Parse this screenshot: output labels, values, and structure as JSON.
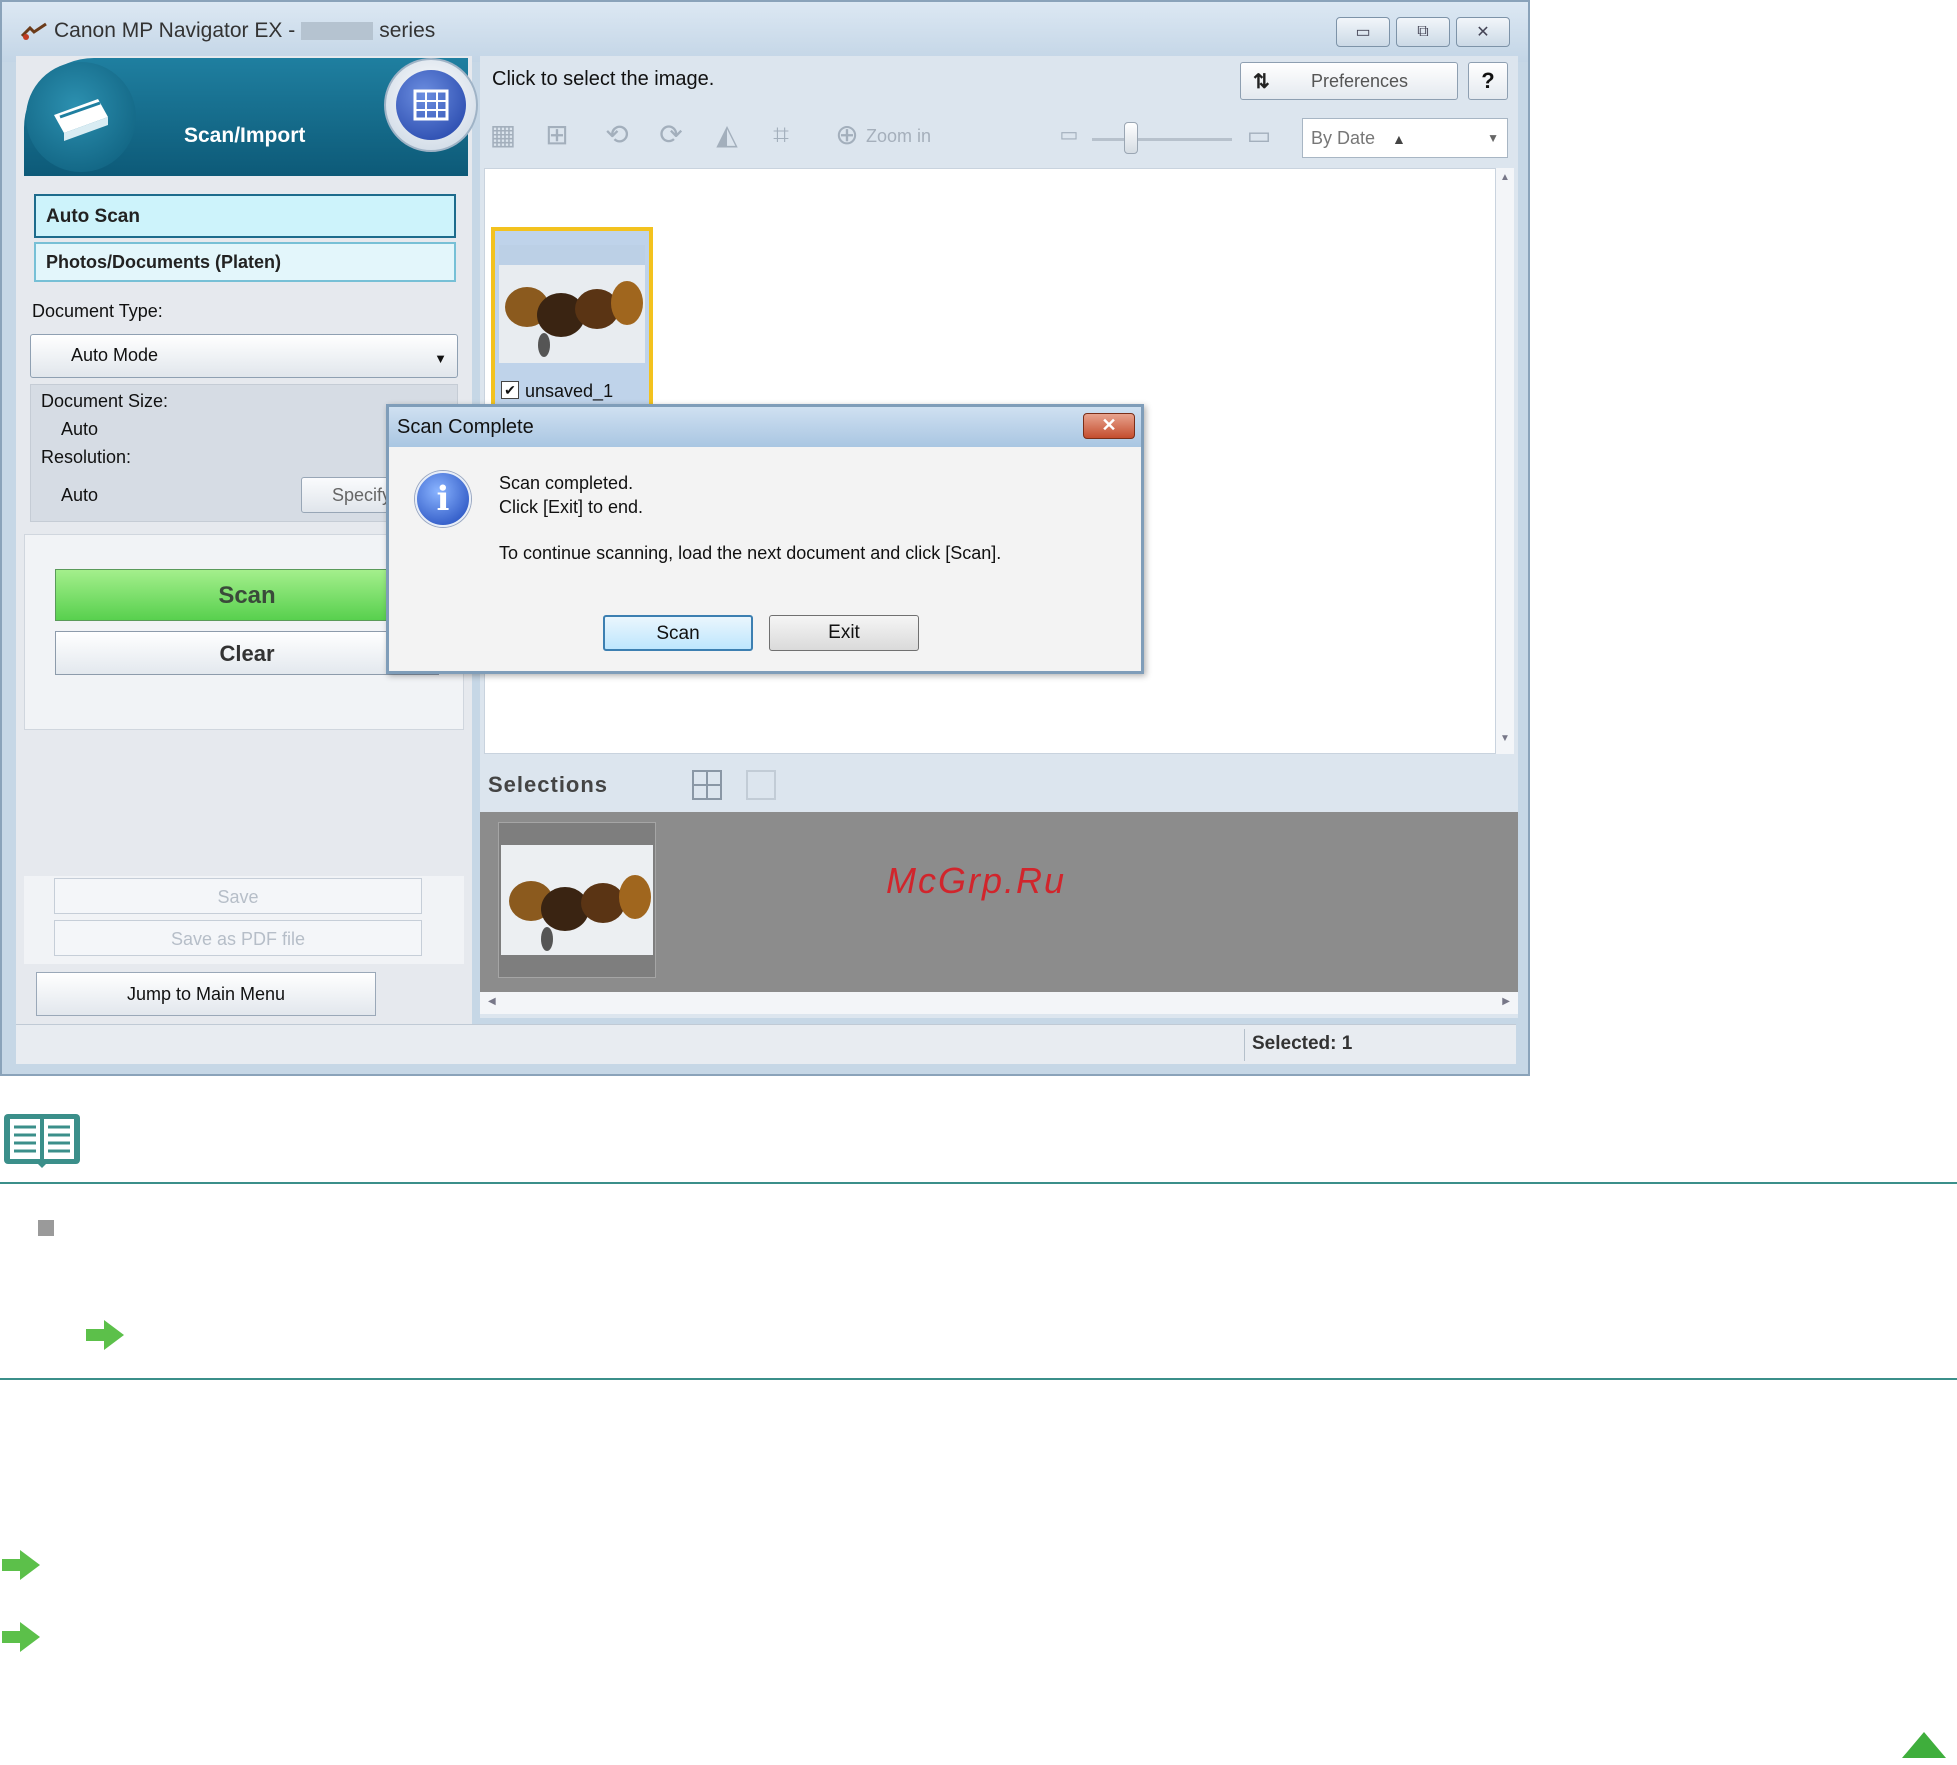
{
  "window": {
    "title_prefix": "Canon MP Navigator EX -",
    "title_suffix": "series",
    "controls": {
      "minimize": "▭",
      "restore": "⧉",
      "close": "✕"
    }
  },
  "left_panel": {
    "header_label": "Scan/Import",
    "modes": [
      "Auto Scan",
      "Photos/Documents (Platen)"
    ],
    "document_type_label": "Document Type:",
    "document_type_value": "Auto Mode",
    "document_size_label": "Document Size:",
    "document_size_value": "Auto",
    "resolution_label": "Resolution:",
    "resolution_value": "Auto",
    "specify_label": "Specify...",
    "scan_label": "Scan",
    "clear_label": "Clear",
    "save_label": "Save",
    "save_pdf_label": "Save as PDF file",
    "jump_label": "Jump to Main Menu"
  },
  "right_panel": {
    "instruction": "Click to select the image.",
    "preferences_label": "Preferences",
    "help_label": "?",
    "zoom_label": "Zoom in",
    "sort_value": "By Date",
    "thumbnail_name": "unsaved_1",
    "thumbnail_checked": true,
    "selections_label": "Selections",
    "watermark": "McGrp.Ru"
  },
  "status": {
    "selected": "Selected: 1"
  },
  "dialog": {
    "title": "Scan Complete",
    "line1": "Scan completed.",
    "line2": "Click [Exit] to end.",
    "line3": "To continue scanning, load the next document and click [Scan].",
    "scan_button": "Scan",
    "exit_button": "Exit"
  },
  "colors": {
    "accent_teal": "#3b8f8a",
    "arrow_green": "#5cc04a",
    "scan_green": "#58d04e",
    "thumb_highlight": "#f3c21e"
  },
  "icons": {
    "note": "note-book-icon",
    "arrow": "green-right-arrow-icon",
    "top": "back-to-top-icon",
    "info": "information-icon"
  }
}
